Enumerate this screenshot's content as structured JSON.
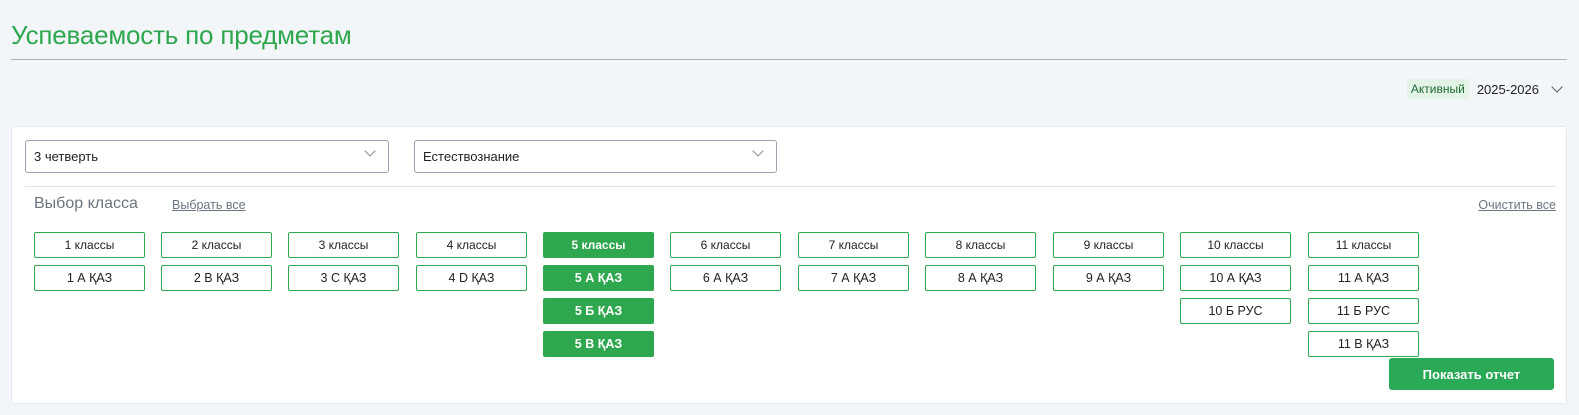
{
  "page": {
    "title": "Успеваемость по предметам"
  },
  "year": {
    "status": "Активный",
    "value": "2025-2026"
  },
  "filters": {
    "quarter": "3 четверть",
    "subject": "Естествознание"
  },
  "class_choice": {
    "label": "Выбор класса",
    "select_all": "Выбрать все",
    "clear_all": "Очистить все"
  },
  "grades": [
    {
      "label": "1 классы",
      "selected": false,
      "classes": [
        {
          "label": "1 А ҚАЗ",
          "selected": false
        }
      ]
    },
    {
      "label": "2 классы",
      "selected": false,
      "classes": [
        {
          "label": "2 В ҚАЗ",
          "selected": false
        }
      ]
    },
    {
      "label": "3 классы",
      "selected": false,
      "classes": [
        {
          "label": "3 С ҚАЗ",
          "selected": false
        }
      ]
    },
    {
      "label": "4 классы",
      "selected": false,
      "classes": [
        {
          "label": "4 D ҚАЗ",
          "selected": false
        }
      ]
    },
    {
      "label": "5 классы",
      "selected": true,
      "classes": [
        {
          "label": "5 А ҚАЗ",
          "selected": true
        },
        {
          "label": "5 Б ҚАЗ",
          "selected": true
        },
        {
          "label": "5 В ҚАЗ",
          "selected": true
        }
      ]
    },
    {
      "label": "6 классы",
      "selected": false,
      "classes": [
        {
          "label": "6 А ҚАЗ",
          "selected": false
        }
      ]
    },
    {
      "label": "7 классы",
      "selected": false,
      "classes": [
        {
          "label": "7 А ҚАЗ",
          "selected": false
        }
      ]
    },
    {
      "label": "8 классы",
      "selected": false,
      "classes": [
        {
          "label": "8 А ҚАЗ",
          "selected": false
        }
      ]
    },
    {
      "label": "9 классы",
      "selected": false,
      "classes": [
        {
          "label": "9 А ҚАЗ",
          "selected": false
        }
      ]
    },
    {
      "label": "10 классы",
      "selected": false,
      "classes": [
        {
          "label": "10 А ҚАЗ",
          "selected": false
        },
        {
          "label": "10 Б РУС",
          "selected": false
        }
      ]
    },
    {
      "label": "11 классы",
      "selected": false,
      "classes": [
        {
          "label": "11 А ҚАЗ",
          "selected": false
        },
        {
          "label": "11 Б РУС",
          "selected": false
        },
        {
          "label": "11 В ҚАЗ",
          "selected": false
        }
      ]
    }
  ],
  "actions": {
    "show_report": "Показать отчет"
  },
  "colors": {
    "accent": "#2fa74f",
    "button": "#2aa956",
    "badge_bg": "#e3f4e6"
  },
  "icons": {
    "dropdown": "chevron-down-icon"
  }
}
